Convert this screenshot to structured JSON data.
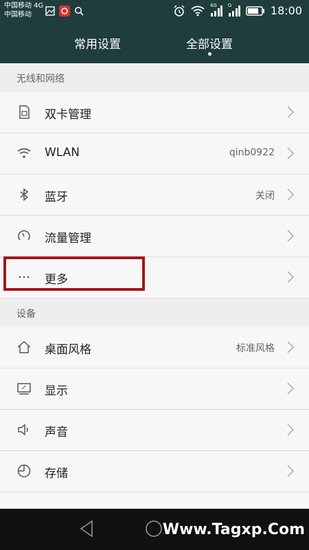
{
  "status_bar": {
    "carrier_line1": "中国移动 4G",
    "carrier_line2": "中国移动",
    "network_badge_1": "4G",
    "network_badge_2": "G",
    "time": "18:00"
  },
  "tabs": [
    {
      "label": "常用设置",
      "selected": false
    },
    {
      "label": "全部设置",
      "selected": true
    }
  ],
  "sections": [
    {
      "title": "无线和网络"
    },
    {
      "title": "设备"
    }
  ],
  "rows": [
    {
      "label": "双卡管理",
      "value": "",
      "icon": "sim-card-icon"
    },
    {
      "label": "WLAN",
      "value": "qinb0922",
      "icon": "wifi-icon"
    },
    {
      "label": "蓝牙",
      "value": "关闭",
      "icon": "bluetooth-icon"
    },
    {
      "label": "流量管理",
      "value": "",
      "icon": "gauge-icon"
    },
    {
      "label": "更多",
      "value": "",
      "icon": "more-icon"
    },
    {
      "label": "桌面风格",
      "value": "标准风格",
      "icon": "home-icon"
    },
    {
      "label": "显示",
      "value": "",
      "icon": "display-icon"
    },
    {
      "label": "声音",
      "value": "",
      "icon": "speaker-icon"
    },
    {
      "label": "存储",
      "value": "",
      "icon": "storage-icon"
    }
  ],
  "watermark": "Www.Tagxp.Com",
  "colors": {
    "header": "#1f3d3d",
    "highlight": "#a3151c",
    "background": "#f3f3f3"
  }
}
